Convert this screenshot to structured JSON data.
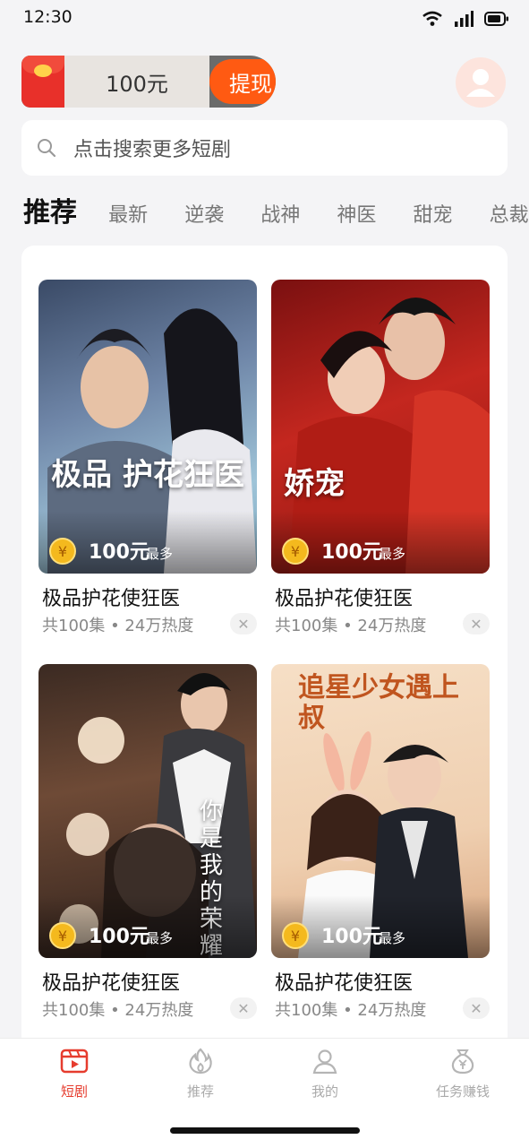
{
  "status": {
    "time": "12:30"
  },
  "reward": {
    "amount": "100元",
    "withdraw_label": "提现"
  },
  "search": {
    "placeholder": "点击搜索更多短剧"
  },
  "tabs": [
    "推荐",
    "最新",
    "逆袭",
    "战神",
    "神医",
    "甜宠",
    "总裁"
  ],
  "items": [
    {
      "title": "极品护花使狂医",
      "meta": "共100集 • 24万热度",
      "reward": "100元",
      "reward_suffix": "最多",
      "poster_text": "极品 护花狂医"
    },
    {
      "title": "极品护花使狂医",
      "meta": "共100集 • 24万热度",
      "reward": "100元",
      "reward_suffix": "最多",
      "poster_text": "娇宠"
    },
    {
      "title": "极品护花使狂医",
      "meta": "共100集 • 24万热度",
      "reward": "100元",
      "reward_suffix": "最多",
      "poster_text": "你是我的荣耀"
    },
    {
      "title": "极品护花使狂医",
      "meta": "共100集 • 24万热度",
      "reward": "100元",
      "reward_suffix": "最多",
      "poster_text": "追星少女遇上叔"
    }
  ],
  "nav": [
    {
      "label": "短剧",
      "icon": "video-icon",
      "active": true
    },
    {
      "label": "推荐",
      "icon": "flame-icon",
      "active": false
    },
    {
      "label": "我的",
      "icon": "user-icon",
      "active": false
    },
    {
      "label": "任务赚钱",
      "icon": "money-bag-icon",
      "active": false
    }
  ],
  "colors": {
    "accent": "#ff5a12",
    "nav_active": "#e63c2e"
  }
}
